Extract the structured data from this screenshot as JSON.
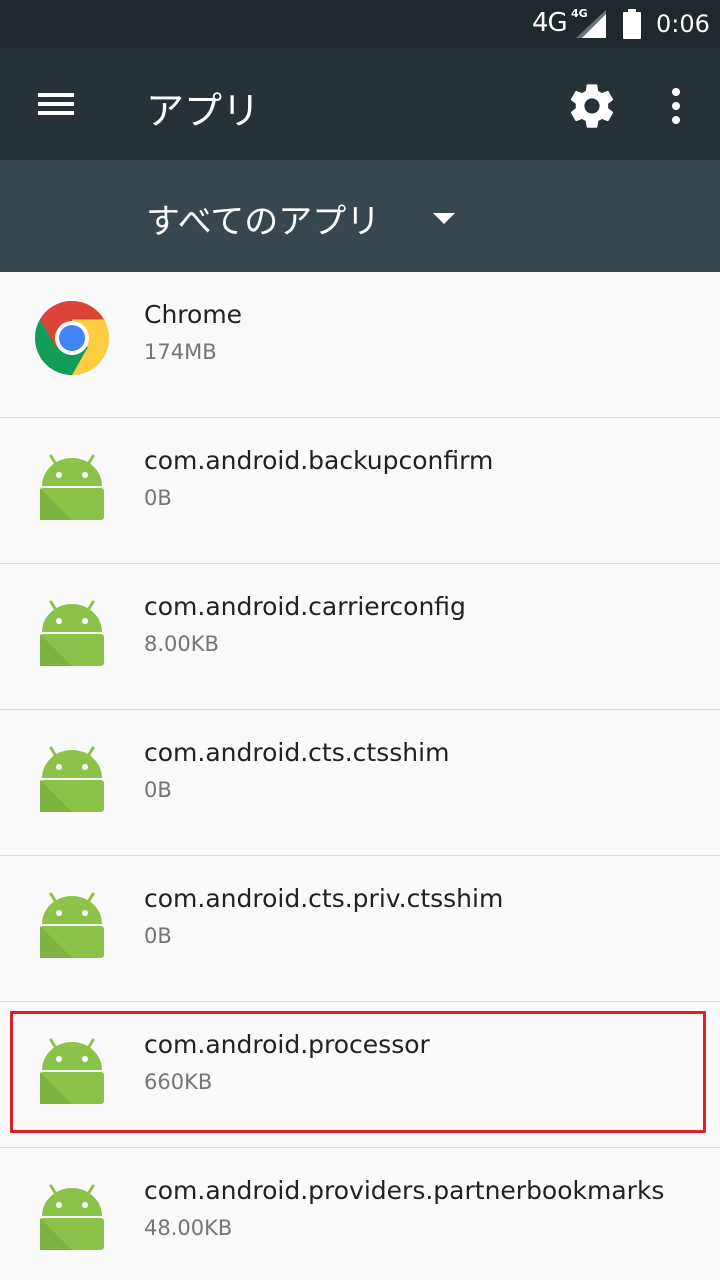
{
  "status_bar": {
    "network": "4G",
    "network_small": "4G",
    "time": "0:06",
    "icons": [
      "signal-icon",
      "battery-icon"
    ]
  },
  "toolbar": {
    "title": "アプリ",
    "icons": [
      "menu-icon",
      "gear-icon",
      "more-vert-icon"
    ]
  },
  "filter": {
    "selected": "すべてのアプリ",
    "icon": "dropdown-arrow-icon"
  },
  "apps": [
    {
      "name": "Chrome",
      "size": "174MB",
      "icon": "chrome-icon"
    },
    {
      "name": "com.android.backupconfirm",
      "size": "0B",
      "icon": "android-icon"
    },
    {
      "name": "com.android.carrierconfig",
      "size": "8.00KB",
      "icon": "android-icon"
    },
    {
      "name": "com.android.cts.ctsshim",
      "size": "0B",
      "icon": "android-icon"
    },
    {
      "name": "com.android.cts.priv.ctsshim",
      "size": "0B",
      "icon": "android-icon"
    },
    {
      "name": "com.android.processor",
      "size": "660KB",
      "icon": "android-icon",
      "highlighted": true
    },
    {
      "name": "com.android.providers.partnerbookmarks",
      "size": "48.00KB",
      "icon": "android-icon"
    }
  ],
  "colors": {
    "status_bar": "#1e282d",
    "toolbar": "#263238",
    "filter_bar": "#37474f",
    "list_bg": "#fafafa",
    "highlight": "#e0202c",
    "android_green": "#8bc34a"
  }
}
